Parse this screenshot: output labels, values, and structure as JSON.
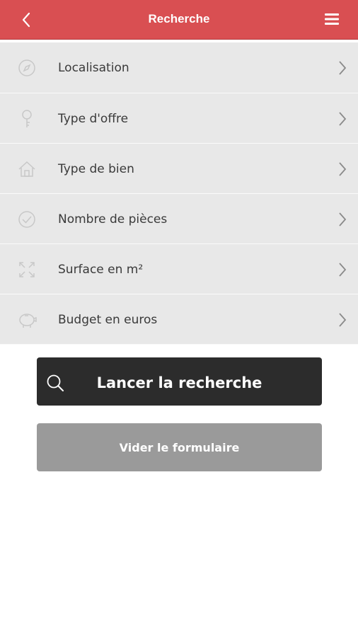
{
  "header": {
    "title": "Recherche",
    "back_icon": "chevron-left-icon",
    "menu_icon": "hamburger-menu-icon",
    "background_color": "#d94f52"
  },
  "criteria": [
    {
      "label": "Localisation",
      "icon": "compass-icon"
    },
    {
      "label": "Type d'offre",
      "icon": "key-icon"
    },
    {
      "label": "Type de bien",
      "icon": "house-icon"
    },
    {
      "label": "Nombre de pièces",
      "icon": "check-circle-icon"
    },
    {
      "label": "Surface en m²",
      "icon": "expand-arrows-icon"
    },
    {
      "label": "Budget en euros",
      "icon": "piggy-bank-icon"
    }
  ],
  "actions": {
    "search_label": "Lancer la recherche",
    "search_icon": "search-icon",
    "clear_label": "Vider le formulaire"
  }
}
